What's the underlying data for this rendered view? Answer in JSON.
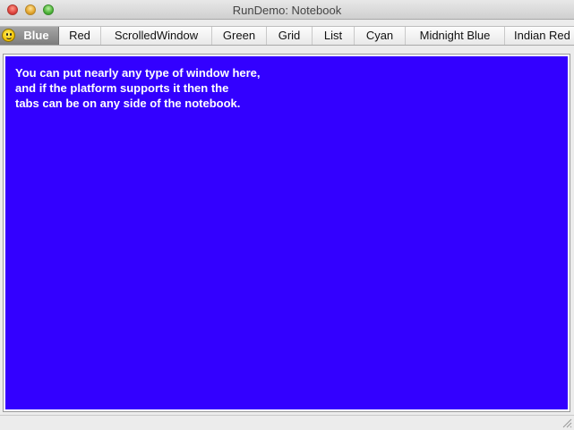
{
  "window": {
    "title": "RunDemo: Notebook"
  },
  "tabs": [
    {
      "label": "Blue",
      "selected": true,
      "icon": "smiley-icon"
    },
    {
      "label": "Red"
    },
    {
      "label": "ScrolledWindow"
    },
    {
      "label": "Green"
    },
    {
      "label": "Grid"
    },
    {
      "label": "List"
    },
    {
      "label": "Cyan"
    },
    {
      "label": "Midnight Blue"
    },
    {
      "label": "Indian Red"
    }
  ],
  "page": {
    "background": "#3300ff",
    "line1": "You can put nearly any type of window here,",
    "line2": "and if the platform supports it then the",
    "line3": "tabs can be on any side of the notebook."
  }
}
